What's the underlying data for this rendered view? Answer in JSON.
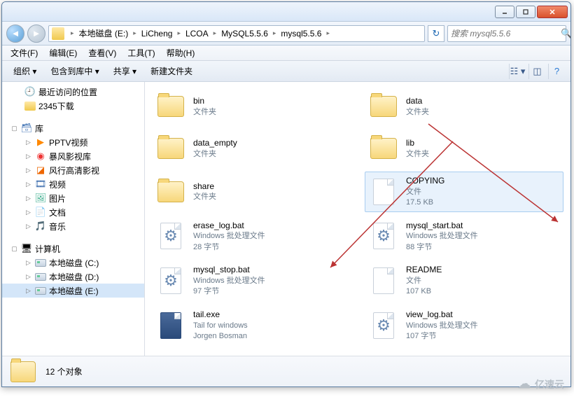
{
  "titlebar": {
    "min_tip": "最小化",
    "max_tip": "最大化",
    "close_tip": "关闭"
  },
  "breadcrumb": {
    "segments": [
      "本地磁盘 (E:)",
      "LiCheng",
      "LCOA",
      "MySQL5.5.6",
      "mysql5.5.6"
    ]
  },
  "search": {
    "placeholder": "搜索 mysql5.5.6"
  },
  "menu": {
    "file": "文件(F)",
    "edit": "编辑(E)",
    "view": "查看(V)",
    "tools": "工具(T)",
    "help": "帮助(H)"
  },
  "toolbar": {
    "organize": "组织 ▾",
    "include": "包含到库中 ▾",
    "share": "共享 ▾",
    "newfolder": "新建文件夹"
  },
  "sidebar": {
    "recent": "最近访问的位置",
    "dl2345": "2345下载",
    "lib": "库",
    "pptv": "PPTV视频",
    "storm": "暴风影视库",
    "funshion": "风行高清影视",
    "video": "视频",
    "pictures": "图片",
    "documents": "文档",
    "music": "音乐",
    "computer": "计算机",
    "drive_c": "本地磁盘 (C:)",
    "drive_d": "本地磁盘 (D:)",
    "drive_e": "本地磁盘 (E:)"
  },
  "files": [
    {
      "name": "bin",
      "type": "文件夹",
      "kind": "folder"
    },
    {
      "name": "data",
      "type": "文件夹",
      "kind": "folder"
    },
    {
      "name": "data_empty",
      "type": "文件夹",
      "kind": "folder"
    },
    {
      "name": "lib",
      "type": "文件夹",
      "kind": "folder"
    },
    {
      "name": "share",
      "type": "文件夹",
      "kind": "folder"
    },
    {
      "name": "COPYING",
      "type": "文件",
      "size": "17.5 KB",
      "kind": "file",
      "selected": true
    },
    {
      "name": "erase_log.bat",
      "type": "Windows 批处理文件",
      "size": "28 字节",
      "kind": "bat"
    },
    {
      "name": "mysql_start.bat",
      "type": "Windows 批处理文件",
      "size": "88 字节",
      "kind": "bat"
    },
    {
      "name": "mysql_stop.bat",
      "type": "Windows 批处理文件",
      "size": "97 字节",
      "kind": "bat"
    },
    {
      "name": "README",
      "type": "文件",
      "size": "107 KB",
      "kind": "file"
    },
    {
      "name": "tail.exe",
      "type": "Tail for windows",
      "size": "Jorgen Bosman",
      "kind": "exe"
    },
    {
      "name": "view_log.bat",
      "type": "Windows 批处理文件",
      "size": "107 字节",
      "kind": "bat"
    }
  ],
  "status": {
    "count": "12 个对象"
  },
  "watermark": "亿速云"
}
